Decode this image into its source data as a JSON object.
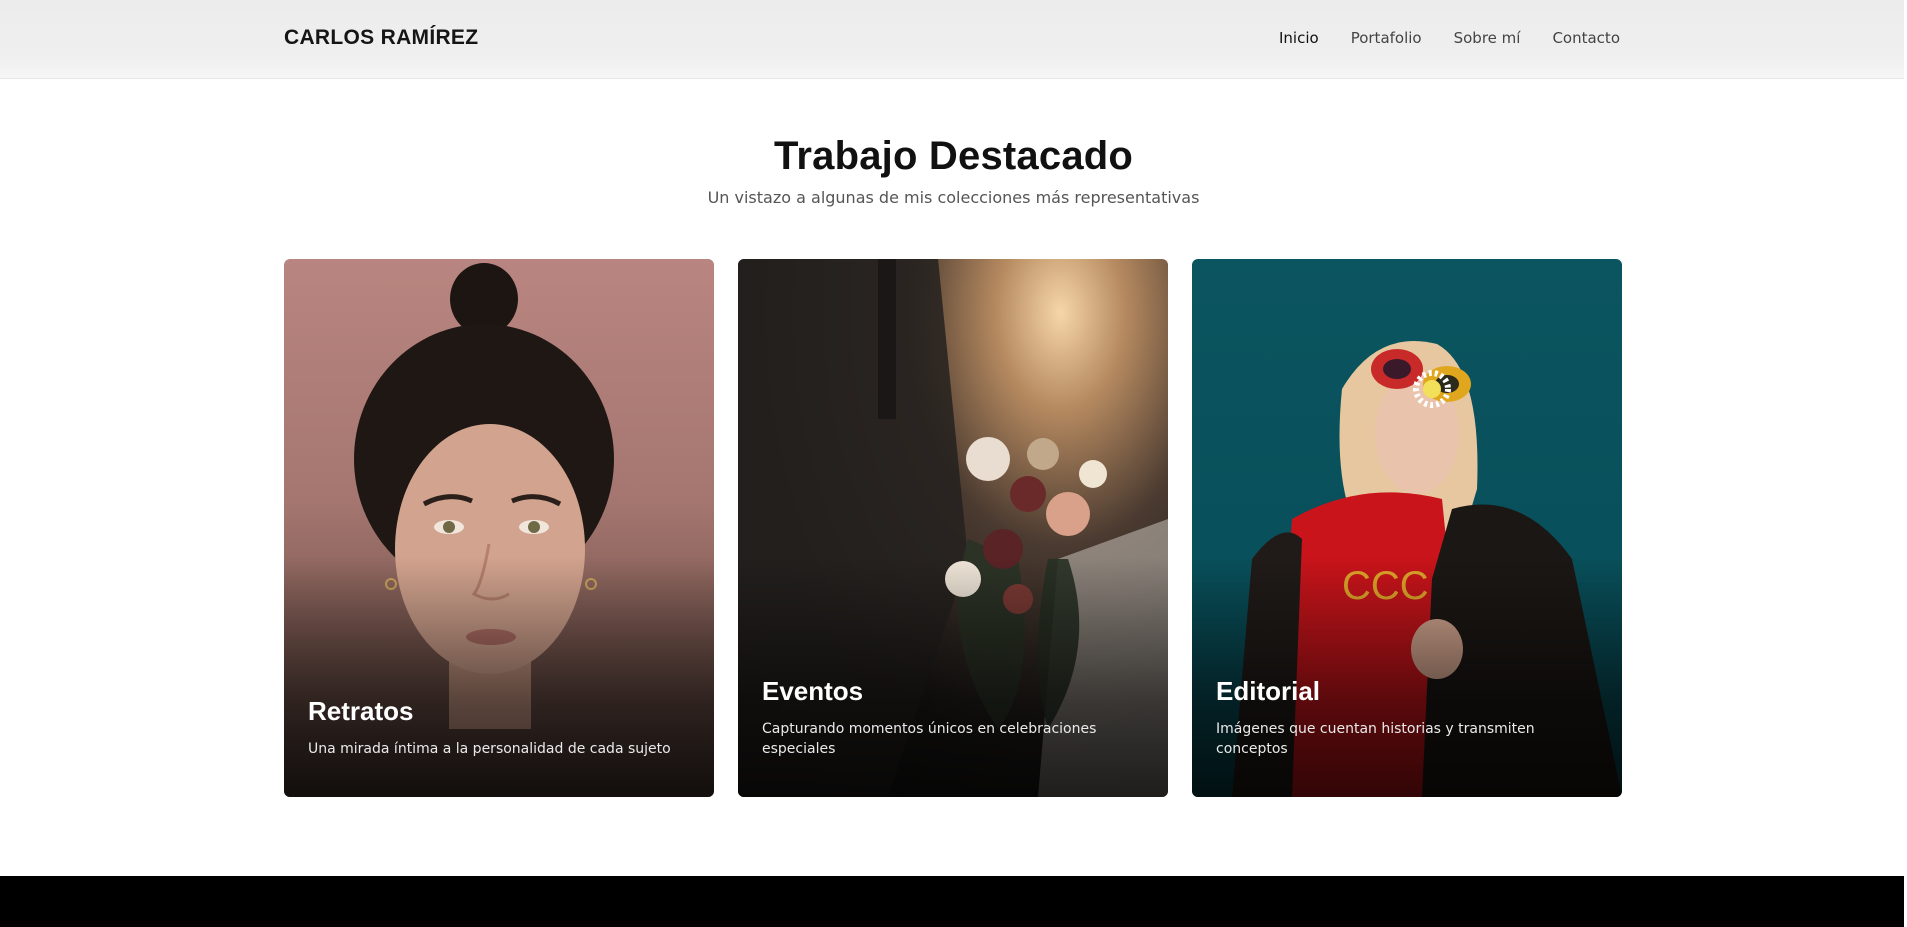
{
  "header": {
    "logo": "CARLOS RAMÍREZ",
    "nav": [
      {
        "label": "Inicio",
        "active": true
      },
      {
        "label": "Portafolio",
        "active": false
      },
      {
        "label": "Sobre mí",
        "active": false
      },
      {
        "label": "Contacto",
        "active": false
      }
    ]
  },
  "section": {
    "title": "Trabajo Destacado",
    "subtitle": "Un vistazo a algunas de mis colecciones más representativas"
  },
  "cards": [
    {
      "title": "Retratos",
      "description": "Una mirada íntima a la personalidad de cada sujeto",
      "image": "portrait-photo"
    },
    {
      "title": "Eventos",
      "description": "Capturando momentos únicos en celebraciones especiales",
      "image": "wedding-bouquet-photo"
    },
    {
      "title": "Editorial",
      "description": "Imágenes que cuentan historias y transmiten conceptos",
      "image": "editorial-fashion-photo"
    }
  ],
  "colors": {
    "header_bg": "#ececec",
    "footer_bg": "#000000",
    "retratos_bg": "#b98580",
    "editorial_bg": "#0b5560"
  }
}
